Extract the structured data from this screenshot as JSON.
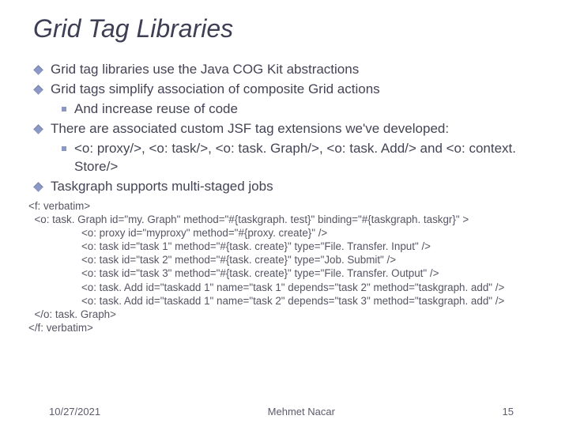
{
  "title": "Grid Tag Libraries",
  "bullets": {
    "b1": "Grid tag libraries use the Java COG Kit abstractions",
    "b2": "Grid tags simplify association of composite Grid actions",
    "b2_1": "And increase reuse of code",
    "b3": "There are associated custom JSF tag extensions we've developed:",
    "b3_1": "<o: proxy/>, <o: task/>, <o: task. Graph/>, <o: task. Add/> and <o: context. Store/>",
    "b4": "Taskgraph supports multi-staged jobs"
  },
  "code": {
    "l1": "<f: verbatim>",
    "l2": "  <o: task. Graph id=\"my. Graph\" method=\"#{taskgraph. test}\" binding=\"#{taskgraph. taskgr}\" >",
    "l3": "                  <o: proxy id=\"myproxy\" method=\"#{proxy. create}\" />",
    "l4": "                  <o: task id=\"task 1\" method=\"#{task. create}\" type=\"File. Transfer. Input\" />",
    "l5": "                  <o: task id=\"task 2\" method=\"#{task. create}\" type=\"Job. Submit\" />",
    "l6": "                  <o: task id=\"task 3\" method=\"#{task. create}\" type=\"File. Transfer. Output\" />",
    "l7": "                  <o: task. Add id=\"taskadd 1\" name=\"task 1\" depends=\"task 2\" method=\"taskgraph. add\" />",
    "l8": "                  <o: task. Add id=\"taskadd 1\" name=\"task 2\" depends=\"task 3\" method=\"taskgraph. add\" />",
    "l9": "  </o: task. Graph>",
    "l10": "</f: verbatim>"
  },
  "footer": {
    "date": "10/27/2021",
    "author": "Mehmet Nacar",
    "page": "15"
  }
}
